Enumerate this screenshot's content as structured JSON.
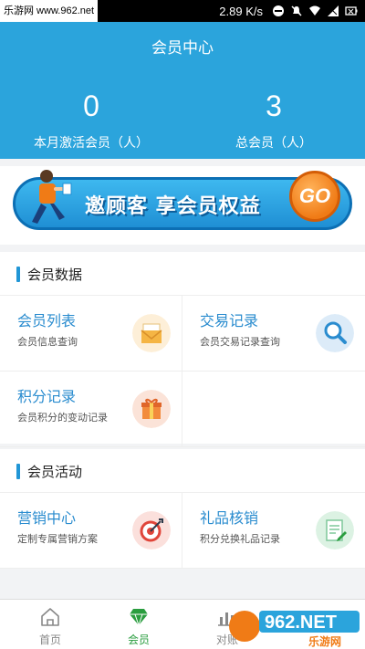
{
  "status_bar": {
    "watermark": "乐游网 www.962.net",
    "speed": "2.89 K/s"
  },
  "header": {
    "title": "会员中心",
    "stats": [
      {
        "value": "0",
        "label": "本月激活会员（人）"
      },
      {
        "value": "3",
        "label": "总会员（人）"
      }
    ]
  },
  "banner": {
    "text": "邀顾客  享会员权益",
    "button": "GO"
  },
  "member_data": {
    "title": "会员数据",
    "items": [
      {
        "title": "会员列表",
        "subtitle": "会员信息查询",
        "icon": "envelope-icon"
      },
      {
        "title": "交易记录",
        "subtitle": "会员交易记录查询",
        "icon": "magnifier-icon"
      },
      {
        "title": "积分记录",
        "subtitle": "会员积分的变动记录",
        "icon": "gift-icon"
      }
    ]
  },
  "member_activity": {
    "title": "会员活动",
    "items": [
      {
        "title": "营销中心",
        "subtitle": "定制专属营销方案",
        "icon": "target-icon"
      },
      {
        "title": "礼品核销",
        "subtitle": "积分兑换礼品记录",
        "icon": "document-icon"
      }
    ]
  },
  "tabbar": {
    "tabs": [
      {
        "label": "首页",
        "icon": "home-icon",
        "active": false
      },
      {
        "label": "会员",
        "icon": "diamond-icon",
        "active": true
      },
      {
        "label": "对账",
        "icon": "chart-icon",
        "active": false
      }
    ]
  },
  "watermark": "962.NET 乐游网",
  "colors": {
    "header_bg": "#2ba4dc",
    "accent_blue": "#2a8ccf",
    "active_green": "#2a9d3f",
    "go_orange": "#f07b16"
  }
}
